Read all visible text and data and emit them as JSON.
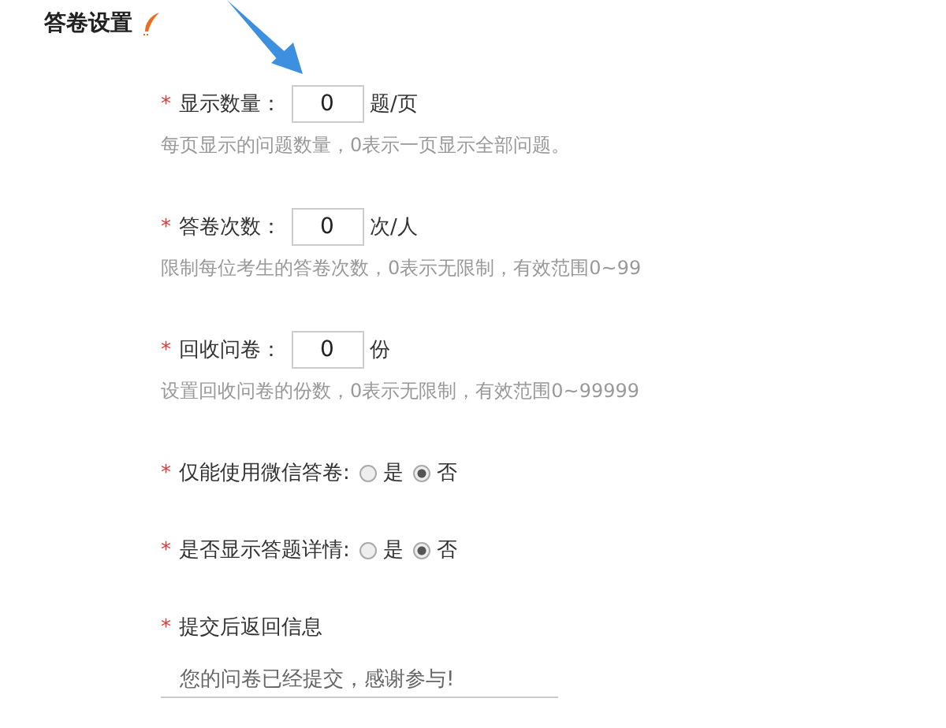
{
  "section": {
    "title": "答卷设置"
  },
  "fields": [
    {
      "kind": "number",
      "required_mark": "*",
      "label": "显示数量：",
      "value": "0",
      "unit": "题/页",
      "hint": "每页显示的问题数量，0表示一页显示全部问题。"
    },
    {
      "kind": "number",
      "required_mark": "*",
      "label": "答卷次数：",
      "value": "0",
      "unit": "次/人",
      "hint": "限制每位考生的答卷次数，0表示无限制，有效范围0~99"
    },
    {
      "kind": "number",
      "required_mark": "*",
      "label": "回收问卷：",
      "value": "0",
      "unit": "份",
      "hint": "设置回收问卷的份数，0表示无限制，有效范围0~99999"
    },
    {
      "kind": "radio",
      "required_mark": "*",
      "label": "仅能使用微信答卷:",
      "options": [
        {
          "label": "是",
          "selected": false
        },
        {
          "label": "否",
          "selected": true
        }
      ]
    },
    {
      "kind": "radio",
      "required_mark": "*",
      "label": "是否显示答题详情:",
      "options": [
        {
          "label": "是",
          "selected": false
        },
        {
          "label": "否",
          "selected": true
        }
      ]
    },
    {
      "kind": "text",
      "required_mark": "*",
      "label": "提交后返回信息",
      "value": "您的问卷已经提交，感谢参与!"
    }
  ]
}
